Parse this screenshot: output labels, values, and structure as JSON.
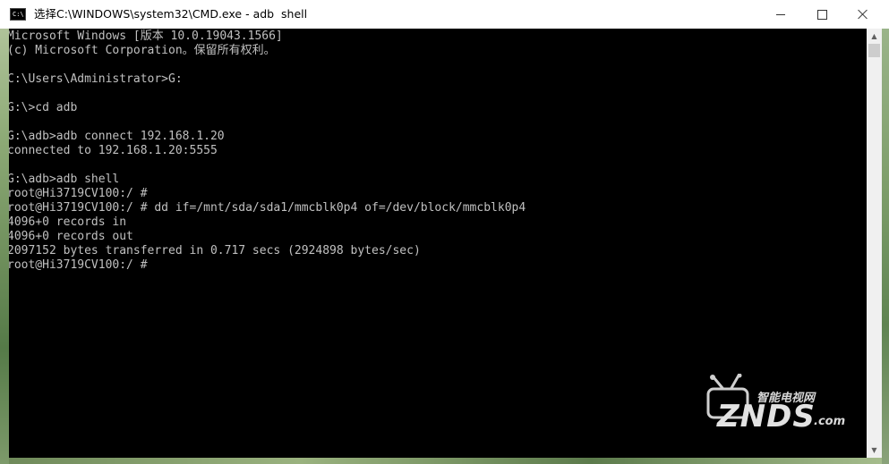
{
  "window": {
    "title": "选择C:\\WINDOWS\\system32\\CMD.exe - adb  shell",
    "icon": "cmd-icon",
    "icon_text": "C:\\",
    "controls": {
      "minimize": "minimize-icon",
      "maximize": "maximize-icon",
      "close": "close-icon"
    }
  },
  "console": {
    "text_color": "#c0c0c0",
    "background": "#000000",
    "lines": [
      "Microsoft Windows [版本 10.0.19043.1566]",
      "(c) Microsoft Corporation。保留所有权利。",
      "",
      "C:\\Users\\Administrator>G:",
      "",
      "G:\\>cd adb",
      "",
      "G:\\adb>adb connect 192.168.1.20",
      "connected to 192.168.1.20:5555",
      "",
      "G:\\adb>adb shell",
      "root@Hi3719CV100:/ #",
      "root@Hi3719CV100:/ # dd if=/mnt/sda/sda1/mmcblk0p4 of=/dev/block/mmcblk0p4",
      "4096+0 records in",
      "4096+0 records out",
      "2097152 bytes transferred in 0.717 secs (2924898 bytes/sec)",
      "root@Hi3719CV100:/ #"
    ]
  },
  "scrollbar": {
    "up": "scroll-up-arrow-icon",
    "down": "scroll-down-arrow-icon",
    "up_glyph": "▲",
    "down_glyph": "▼"
  },
  "watermark": {
    "cn_text": "智能电视网",
    "brand": "ZNDS",
    "domain": ".com",
    "icon": "tv-antenna-logo"
  }
}
